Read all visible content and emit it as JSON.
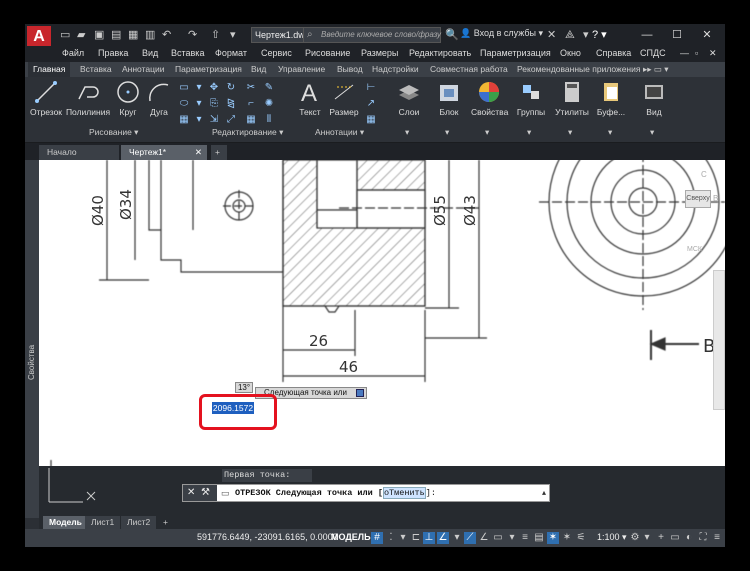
{
  "title_bar": {
    "doc_title": "Чертеж1.dwg",
    "search_placeholder": "Введите ключевое слово/фразу",
    "signin": "Вход в службы",
    "help": "?"
  },
  "menu": [
    "Файл",
    "Правка",
    "Вид",
    "Вставка",
    "Формат",
    "Сервис",
    "Рисование",
    "Размеры",
    "Редактировать",
    "Параметризация",
    "Окно",
    "Справка",
    "СПДС"
  ],
  "ribbon_tabs": [
    "Главная",
    "Вставка",
    "Аннотации",
    "Параметризация",
    "Вид",
    "Управление",
    "Вывод",
    "Надстройки",
    "Совместная работа",
    "Рекомендованные приложения"
  ],
  "ribbon": {
    "draw_tools": [
      "Отрезок",
      "Полилиния",
      "Круг",
      "Дуга"
    ],
    "draw_panel": "Рисование ▾",
    "modify_panel": "Редактирование ▾",
    "annot_tools": [
      "Текст",
      "Размер"
    ],
    "annot_panel": "Аннотации ▾",
    "other_tools": [
      "Слои",
      "Блок",
      "Свойства",
      "Группы",
      "Утилиты",
      "Буфе...",
      "Вид"
    ]
  },
  "file_tabs": [
    "Начало",
    "Чертеж1*"
  ],
  "drawing": {
    "dims": [
      "Ø40",
      "Ø34",
      "Ø55",
      "Ø43",
      "26",
      "46",
      "B"
    ],
    "viewcube": [
      "С",
      "Сверху",
      "В",
      "МСК"
    ]
  },
  "dynamic_input": {
    "angle": "13°",
    "prompt": "Следующая точка или",
    "value": "2096.1572"
  },
  "command": {
    "history": "Первая точка:",
    "line_prefix": "ОТРЕЗОК Следующая точка или [",
    "option": "оТменить",
    "line_suffix": "]:"
  },
  "layout_tabs": [
    "Модель",
    "Лист1",
    "Лист2"
  ],
  "status": {
    "coords": "591776.6449, -23091.6165, 0.0000",
    "model": "МОДЕЛЬ",
    "scale": "1:100"
  },
  "props_label": "Свойства",
  "colors": {
    "accent": "#2f6fb0",
    "highlight": "#e4121f",
    "logo": "#c8262c"
  }
}
